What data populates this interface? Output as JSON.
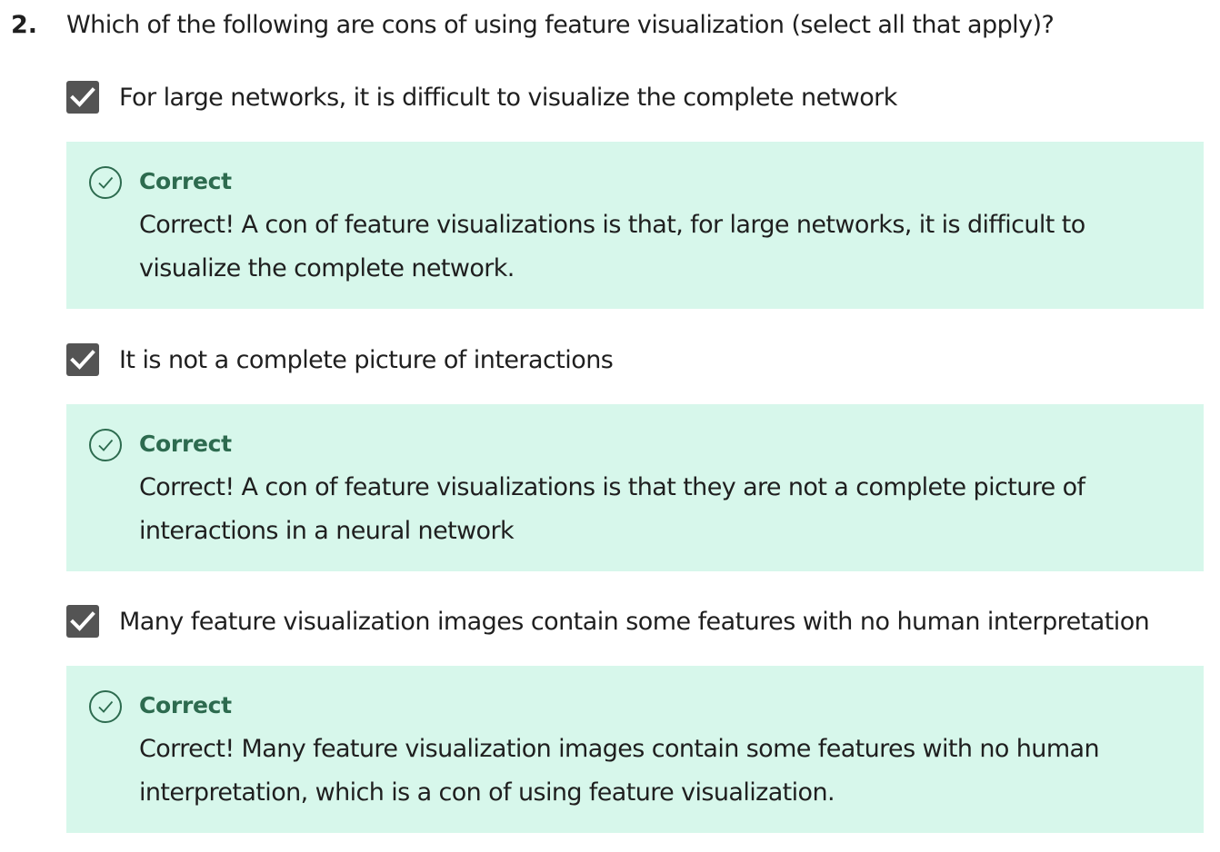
{
  "question": {
    "number": "2.",
    "text": "Which of the following are cons of using feature visualization (select all that apply)?"
  },
  "options": [
    {
      "label": "For large networks, it is difficult to visualize the complete network",
      "checked": true,
      "feedback": {
        "status": "Correct",
        "text": "Correct! A con of feature visualizations is that, for large networks, it is difficult to visualize the complete network."
      }
    },
    {
      "label": "It is not a complete picture of interactions",
      "checked": true,
      "feedback": {
        "status": "Correct",
        "text": "Correct! A con of feature visualizations is that they are not a complete picture of interactions in a neural network"
      }
    },
    {
      "label": "Many feature visualization images contain some features with no human interpretation",
      "checked": true,
      "feedback": {
        "status": "Correct",
        "text": "Correct! Many feature visualization images contain some features with no human interpretation, which is a con of using feature visualization."
      }
    }
  ],
  "colors": {
    "feedback_background": "#d7f7eb",
    "correct_green": "#2d6b4f",
    "checkbox_fill": "#545454"
  },
  "icons": {
    "checkbox": "checkmark-icon",
    "feedback": "check-circle-icon"
  }
}
